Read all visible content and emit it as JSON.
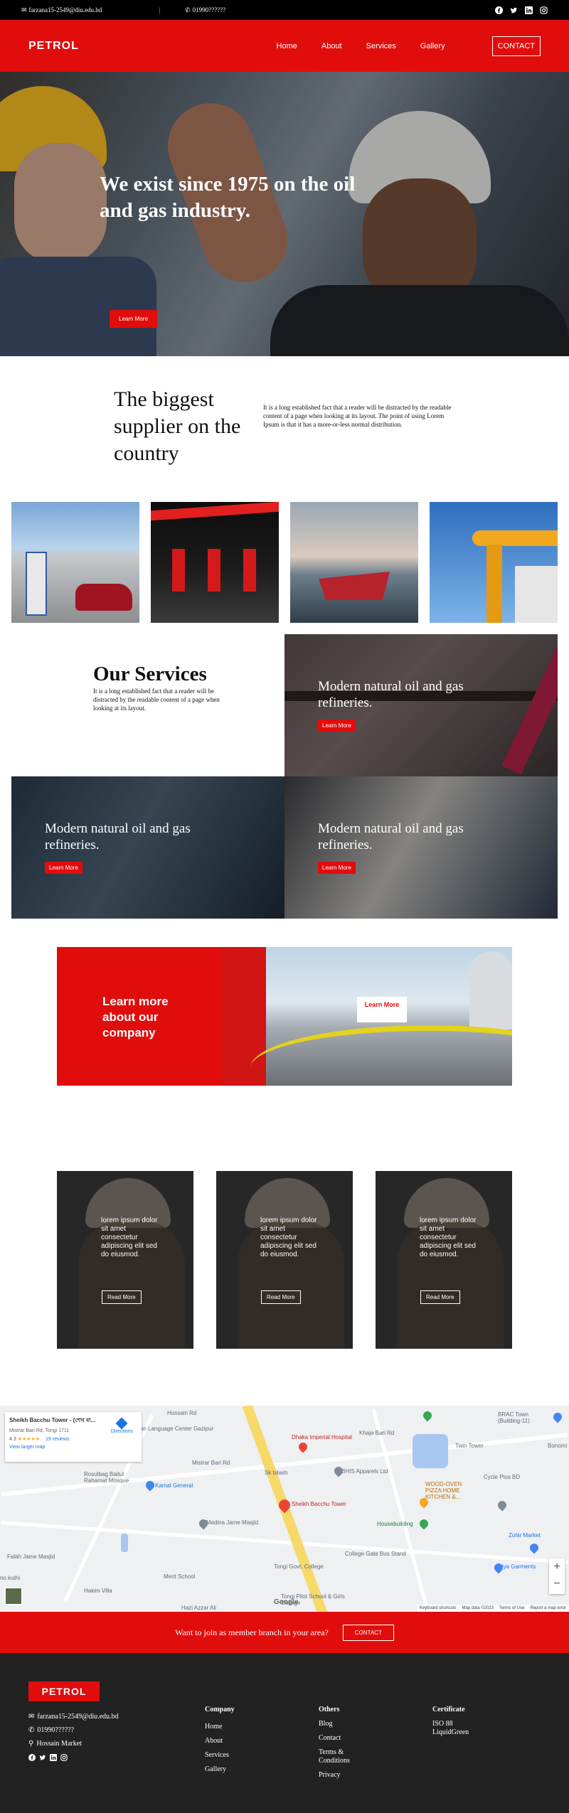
{
  "topbar": {
    "email": "farzana15-2549@diu.edu.bd",
    "separator": "|",
    "phone": "01990??????",
    "social": [
      "facebook-icon",
      "twitter-icon",
      "linkedin-icon",
      "instagram-icon"
    ]
  },
  "nav": {
    "logo": "PETROL",
    "links": [
      "Home",
      "About",
      "Services",
      "Gallery"
    ],
    "contact": "CONTACT"
  },
  "hero": {
    "headline": "We exist since 1975 on the oil and gas industry.",
    "button": "Learn More"
  },
  "supplier": {
    "title": "The biggest supplier on the country",
    "text": "It is a long established fact that a reader will be distracted by the readable content of a page when looking at its layout. The point of using Lorem Ipsum is that it has a more-or-less normal distribution."
  },
  "services": {
    "title": "Our Services",
    "text": "It is a long established fact that a reader will be distracted by the readable content of a page when looking at its layout.",
    "items": [
      {
        "title": "Modern natural oil and gas refineries.",
        "button": "Learn More"
      },
      {
        "title": "Modern natural oil and gas refineries.",
        "button": "Learn More"
      },
      {
        "title": "Modern natural oil and gas refineries.",
        "button": "Learn More"
      }
    ]
  },
  "learn": {
    "title": "Learn more about our company",
    "button": "Learn More"
  },
  "cards": [
    {
      "text": "lorem ipsum dolor sit amet consectetur adipiscing elit sed do eiusmod.",
      "button": "Read More"
    },
    {
      "text": "lorem ipsum dolor sit amet consectetur adipiscing elit sed do eiusmod.",
      "button": "Read More"
    },
    {
      "text": "lorem ipsum dolor sit amet consectetur adipiscing elit sed do eiusmod.",
      "button": "Read More"
    }
  ],
  "map": {
    "place_title": "Sheikh Bacchu Tower - (শেখ বা...",
    "place_address": "Mistrar Bari Rd, Tongi 1711",
    "rating": "4.3",
    "stars": "★★★★★",
    "reviews": "19 reviews",
    "larger_map": "View larger map",
    "directions": "Directions",
    "labels": {
      "korean": "Korean Language Center Gazipur",
      "dhaka_hospital": "Dhaka Imperial Hospital",
      "twin": "Twin Tower",
      "brac": "BRAC Town (Building-11)",
      "bonomi": "Bonomi",
      "rosulbag": "Rosulbag Baitul Rahamat Mosque",
      "kamal": "Kamal General",
      "bilash": "Sk bilash",
      "bhis": "BHIS Apparels Ltd",
      "wood": "WOOD-OVEN PIZZA HOME KITCHEN &...",
      "cycle": "Cycle Plus BD",
      "tower": "Sheikh Bacchu Tower",
      "house": "Housebuilding",
      "zohir": "Zohir Market",
      "madina": "Al-Madina Jame Masjid",
      "falah": "Falah Jame Masjid",
      "college_bus": "College Gate Bus Stand",
      "tongi_college": "Tongi Govt. College",
      "riya": "Riya Garments",
      "merit": "Merit School",
      "hakim": "Hakim Villa",
      "pilot": "Tongi Pilot School & Girls College",
      "hazi": "Hazi Azzar Ali",
      "kuthi": "no kuthi",
      "hossain_rd": "Hossain Rd",
      "khaja": "Khaja Bari Rd",
      "mistar": "Mistrar Bari Rd"
    },
    "google": "Google",
    "footer": [
      "Keyboard shortcuts",
      "Map data ©2023",
      "Terms of Use",
      "Report a map error"
    ],
    "zoom_in": "+",
    "zoom_out": "−"
  },
  "join": {
    "text": "Want to join as member branch in your area?",
    "button": "CONTACT"
  },
  "footer": {
    "logo": "PETROL",
    "email": "farzana15-2549@diu.edu.bd",
    "phone": "01990??????",
    "address": "Hossain Market",
    "company": {
      "title": "Company",
      "items": [
        "Home",
        "About",
        "Services",
        "Gallery"
      ]
    },
    "others": {
      "title": "Others",
      "items": [
        "Blog",
        "Contact",
        "Terms & Conditions",
        "Privacy"
      ]
    },
    "certificate": {
      "title": "Certificate",
      "items": [
        "ISO 88 LiquidGreen"
      ]
    }
  },
  "colors": {
    "accent": "#e10d0d",
    "dark": "#222222",
    "black": "#000000"
  }
}
